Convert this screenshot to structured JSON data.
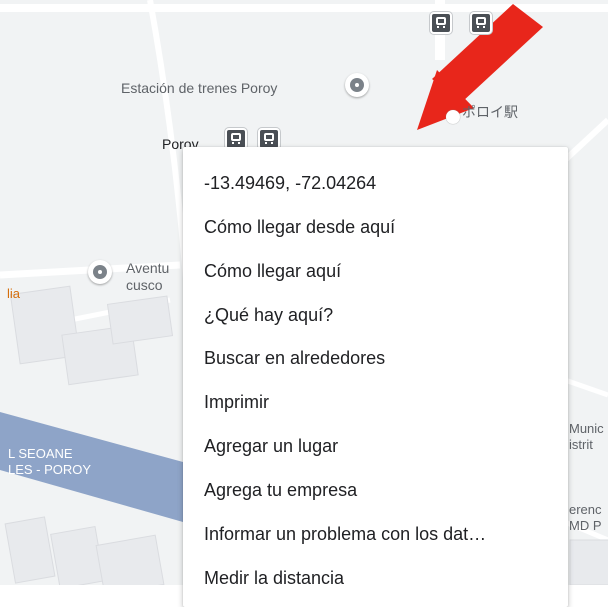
{
  "map": {
    "colors": {
      "background": "#f1f3f4",
      "road": "#ffffff",
      "rail": "#8ea4c8",
      "arrow": "#e8261b"
    },
    "labels": {
      "station_name": "Estación de trenes Poroy",
      "station_jp": "ポロイ駅",
      "porov": "Porov",
      "aventura_1": "Aventu",
      "aventura_2": "cusco",
      "orange_fragment": "lia",
      "street_1": "L SEOANE",
      "street_2": "LES - POROY",
      "muni_1": "Munic",
      "muni_2": "istrit",
      "ref_1": "erenc",
      "ref_2": "MD P"
    },
    "icons": [
      "transit-icon",
      "place-pin-icon"
    ]
  },
  "context_menu": {
    "items": [
      "-13.49469, -72.04264",
      "Cómo llegar desde aquí",
      "Cómo llegar aquí",
      "¿Qué hay aquí?",
      "Buscar en alrededores",
      "Imprimir",
      "Agregar un lugar",
      "Agrega tu empresa",
      "Informar un problema con los dat…",
      "Medir la distancia"
    ]
  }
}
